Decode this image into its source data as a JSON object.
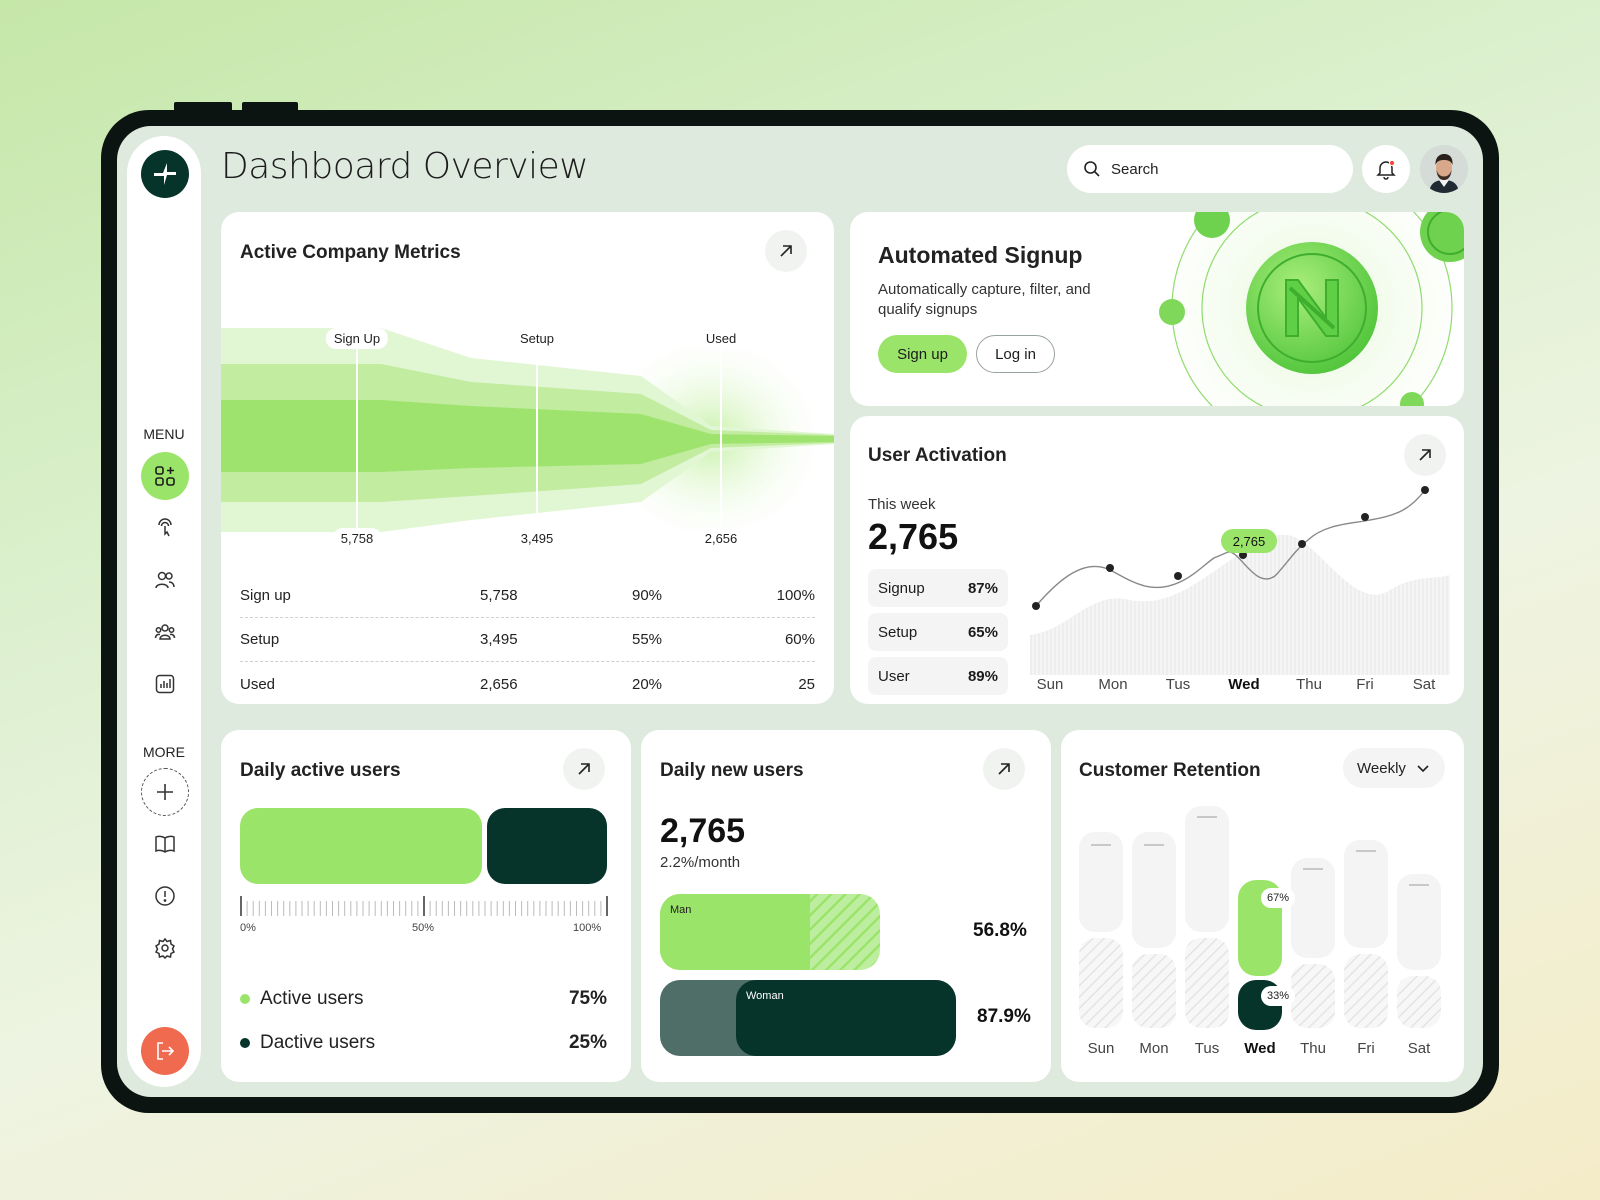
{
  "header": {
    "title": "Dashboard Overview",
    "search_placeholder": "Search"
  },
  "sidebar": {
    "menu_label": "MENU",
    "more_label": "MORE",
    "menu_items": [
      {
        "icon": "dashboard-grid-icon",
        "active": true
      },
      {
        "icon": "touch-pointer-icon",
        "active": false
      },
      {
        "icon": "users-icon",
        "active": false
      },
      {
        "icon": "team-icon",
        "active": false
      },
      {
        "icon": "report-chart-icon",
        "active": false
      }
    ],
    "more_items": [
      "add-icon",
      "book-icon",
      "info-icon",
      "settings-icon"
    ],
    "logout_icon": "logout-icon"
  },
  "metrics": {
    "title": "Active Company Metrics",
    "stages": [
      {
        "label": "Sign Up",
        "value": "5,758"
      },
      {
        "label": "Setup",
        "value": "3,495"
      },
      {
        "label": "Used",
        "value": "2,656"
      }
    ],
    "rows": [
      {
        "name": "Sign up",
        "count": "5,758",
        "rate": "90%",
        "total": "100%"
      },
      {
        "name": "Setup",
        "count": "3,495",
        "rate": "55%",
        "total": "60%"
      },
      {
        "name": "Used",
        "count": "2,656",
        "rate": "20%",
        "total": "25"
      }
    ]
  },
  "signup_promo": {
    "title": "Automated Signup",
    "description": "Automatically capture, filter, and qualify signups",
    "signup_label": "Sign up",
    "login_label": "Log in"
  },
  "activation": {
    "title": "User Activation",
    "period": "This week",
    "value": "2,765",
    "stats": [
      {
        "label": "Signup",
        "value": "87%"
      },
      {
        "label": "Setup",
        "value": "65%"
      },
      {
        "label": "User",
        "value": "89%"
      }
    ],
    "days": [
      "Sun",
      "Mon",
      "Tus",
      "Wed",
      "Thu",
      "Fri",
      "Sat"
    ],
    "selected_day": "Wed",
    "tooltip": "2,765"
  },
  "daily_active": {
    "title": "Daily active users",
    "scale": [
      "0%",
      "50%",
      "100%"
    ],
    "legend": [
      {
        "label": "Active users",
        "value": "75%",
        "color": "#9be46a"
      },
      {
        "label": "Dactive users",
        "value": "25%",
        "color": "#06342b"
      }
    ]
  },
  "daily_new": {
    "title": "Daily new users",
    "value": "2,765",
    "growth": "2.2%/month",
    "bars": [
      {
        "label": "Man",
        "value": "56.8%"
      },
      {
        "label": "Woman",
        "value": "87.9%"
      }
    ]
  },
  "retention": {
    "title": "Customer Retention",
    "period": "Weekly",
    "days": [
      "Sun",
      "Mon",
      "Tus",
      "Wed",
      "Thu",
      "Fri",
      "Sat"
    ],
    "selected_day": "Wed",
    "upper_badge": "67%",
    "lower_badge": "33%"
  },
  "colors": {
    "accent": "#9be46a",
    "dark": "#06342b",
    "danger": "#ef6a4e"
  }
}
